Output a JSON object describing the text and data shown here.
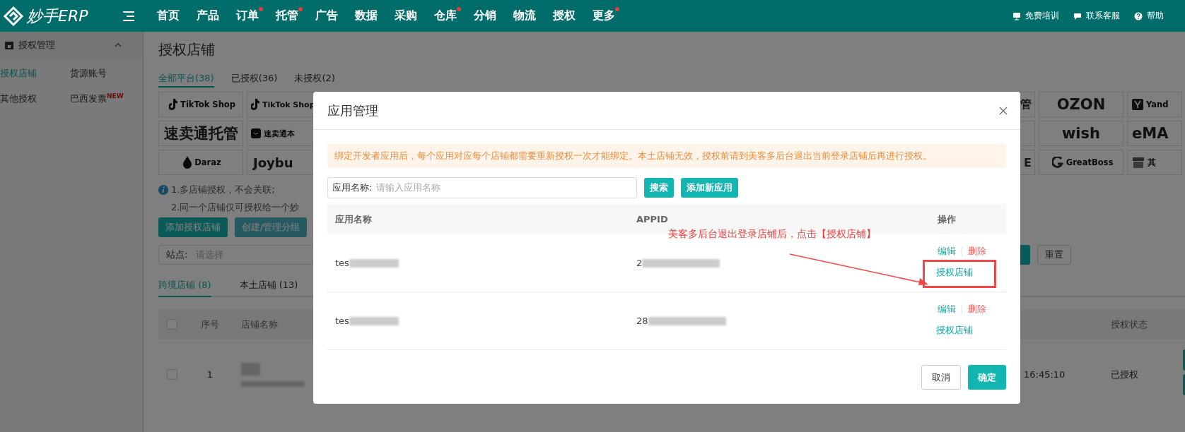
{
  "topbar": {
    "logo": "妙手ERP",
    "nav": [
      {
        "label": "首页",
        "dot": false
      },
      {
        "label": "产品",
        "dot": false
      },
      {
        "label": "订单",
        "dot": true
      },
      {
        "label": "托管",
        "dot": true
      },
      {
        "label": "广告",
        "dot": false
      },
      {
        "label": "数据",
        "dot": false
      },
      {
        "label": "采购",
        "dot": false
      },
      {
        "label": "仓库",
        "dot": true
      },
      {
        "label": "分销",
        "dot": false
      },
      {
        "label": "物流",
        "dot": false
      },
      {
        "label": "授权",
        "dot": false
      },
      {
        "label": "更多",
        "dot": true
      }
    ],
    "links": [
      {
        "label": "免费培训"
      },
      {
        "label": "联系客服"
      },
      {
        "label": "帮助"
      }
    ]
  },
  "sidebar": {
    "title": "授权管理",
    "expanded": true,
    "items": [
      {
        "label": "授权店铺",
        "selected": true
      },
      {
        "label": "货源账号",
        "selected": false
      },
      {
        "label": "其他授权",
        "selected": false
      },
      {
        "label": "巴西发票",
        "selected": false,
        "badge": "NEW"
      }
    ]
  },
  "page": {
    "title": "授权店铺",
    "filter_tabs": [
      {
        "label": "全部平台(38)",
        "selected": true
      },
      {
        "label": "已授权(36)",
        "selected": false
      },
      {
        "label": "未授权(2)",
        "selected": false
      }
    ],
    "platforms_left": [
      {
        "label": "TikTok Shop",
        "kind": "logo"
      },
      {
        "label": "TikTok Shop",
        "kind": "small"
      },
      {
        "label": "速卖通托管",
        "kind": "wordmark"
      },
      {
        "label": "速卖通本",
        "kind": "small"
      },
      {
        "label": "Daraz",
        "kind": "logo"
      },
      {
        "label": "Joybu",
        "kind": "cut"
      }
    ],
    "platforms_right": [
      {
        "label": "管",
        "kind": "tail"
      },
      {
        "label": "OZON",
        "kind": "wordmark"
      },
      {
        "label": "Yand",
        "kind": "logo"
      },
      {
        "kind": "tail"
      },
      {
        "label": "wish",
        "kind": "wordmark"
      },
      {
        "label": "eMA",
        "kind": "wordmark"
      },
      {
        "label": "E",
        "kind": "tail"
      },
      {
        "label": "GreatBoss",
        "kind": "logo"
      },
      {
        "label": "其",
        "kind": "logo"
      }
    ],
    "tips": [
      "1.多店铺授权，不会关联;",
      "2.同一个店铺仅可授权给一个妙"
    ],
    "actions": [
      {
        "label": "添加授权店铺",
        "kind": "primary"
      },
      {
        "label": "创建/管理分组",
        "kind": "secondary"
      }
    ],
    "site_filter": {
      "label": "站点:",
      "placeholder": "请选择"
    },
    "reset_button": "重置",
    "store_tabs": [
      {
        "label": "跨境店铺 (8)",
        "selected": true
      },
      {
        "label": "本土店铺 (13)",
        "selected": false
      }
    ],
    "table": {
      "columns": [
        "序号",
        "店铺名称",
        "授权状态"
      ],
      "all_checked": false,
      "rows": [
        {
          "checked": false,
          "index": "1",
          "time": "16:45:10",
          "status": "已授权"
        }
      ]
    }
  },
  "modal": {
    "title": "应用管理",
    "alert": "绑定开发者应用后，每个应用对应每个店铺都需要重新授权一次才能绑定。本土店铺无效，授权前请到美客多后台退出当前登录店铺后再进行授权。",
    "search": {
      "label": "应用名称:",
      "placeholder": "请输入应用名称"
    },
    "buttons": [
      "搜索",
      "添加新应用"
    ],
    "columns": [
      "应用名称",
      "APPID",
      "操作"
    ],
    "rows": [
      {
        "name": "tes",
        "appid": "2",
        "edit": "编辑",
        "delete": "删除",
        "authorize": "授权店铺",
        "highlighted": true
      },
      {
        "name": "tes",
        "appid": "28",
        "edit": "编辑",
        "delete": "删除",
        "authorize": "授权店铺",
        "highlighted": false
      }
    ],
    "annotation": "美客多后台退出登录店铺后，点击【授权店铺】",
    "footer": [
      {
        "label": "取消",
        "kind": "default"
      },
      {
        "label": "确定",
        "kind": "primary"
      }
    ]
  }
}
